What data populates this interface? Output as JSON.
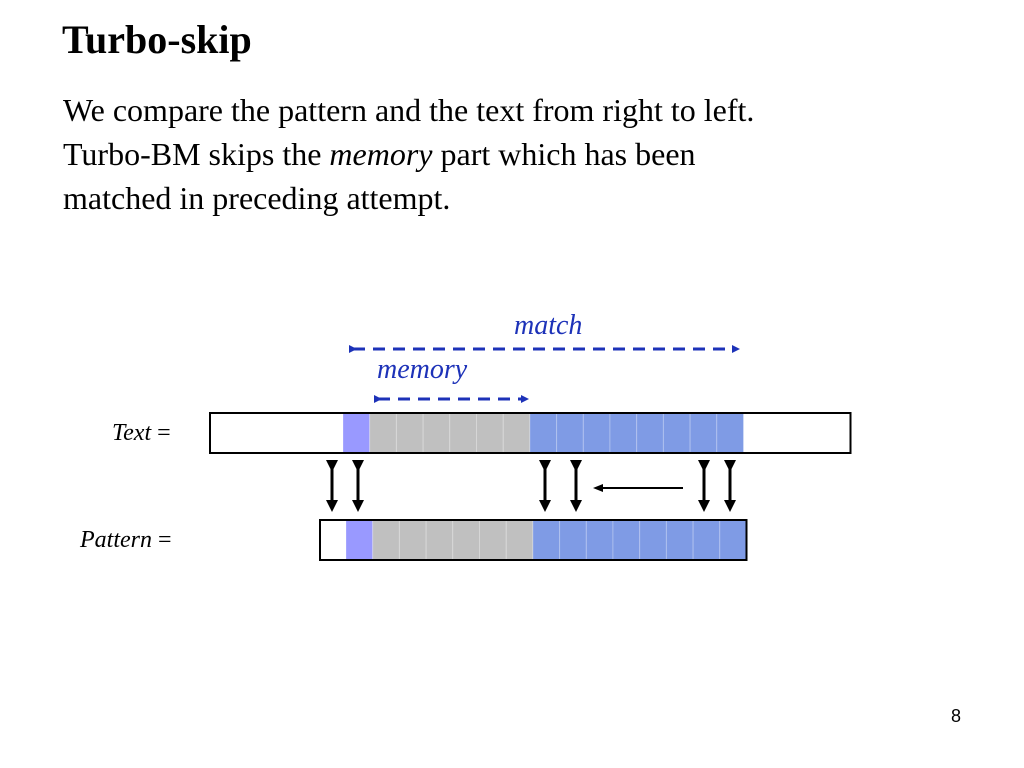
{
  "title": "Turbo-skip",
  "body": {
    "line1": "We compare the pattern and the text from right to left.",
    "line2_pre": "Turbo-BM skips the ",
    "line2_em": "memory",
    "line2_post": " part which has been",
    "line3": "matched in preceding attempt."
  },
  "diagram": {
    "text_label": "Text",
    "pattern_label": "Pattern",
    "equals": " =",
    "match_label": "match",
    "memory_label": "memory",
    "colors": {
      "lavender": "#9999ff",
      "gray": "#c0c0c0",
      "blue": "#7f9be5",
      "arrow_blue": "#1d32b8",
      "border": "#000000"
    },
    "text_cells": [
      {
        "kind": "empty",
        "count": 1
      },
      {
        "kind": "lavender",
        "count": 1
      },
      {
        "kind": "gray",
        "count": 6
      },
      {
        "kind": "blue",
        "count": 8
      },
      {
        "kind": "empty",
        "count": 1
      }
    ],
    "pattern_cells": [
      {
        "kind": "empty",
        "count": 1
      },
      {
        "kind": "lavender",
        "count": 1
      },
      {
        "kind": "gray",
        "count": 6
      },
      {
        "kind": "blue",
        "count": 8
      }
    ],
    "comparison_arrows": 6,
    "scan_direction": "right-to-left"
  },
  "page_number": "8"
}
